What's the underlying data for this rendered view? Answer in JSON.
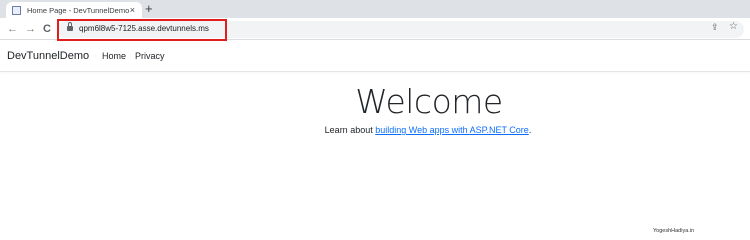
{
  "browser": {
    "tab": {
      "title": "Home Page - DevTunnelDemo",
      "close": "×"
    },
    "new_tab": "+",
    "back": "←",
    "forward": "→",
    "reload": "C",
    "url": "qpm6l8w5-7125.asse.devtunnels.ms",
    "share": "⇪",
    "star": "☆",
    "highlight_color": "#e01e1e"
  },
  "site": {
    "brand": "DevTunnelDemo",
    "nav": [
      {
        "label": "Home"
      },
      {
        "label": "Privacy"
      }
    ],
    "heading": "Welcome",
    "lead_prefix": "Learn about ",
    "lead_link": "building Web apps with ASP.NET Core",
    "lead_suffix": ".",
    "link_color": "#0d6efd"
  },
  "watermark": "YogeshHadiya.in"
}
